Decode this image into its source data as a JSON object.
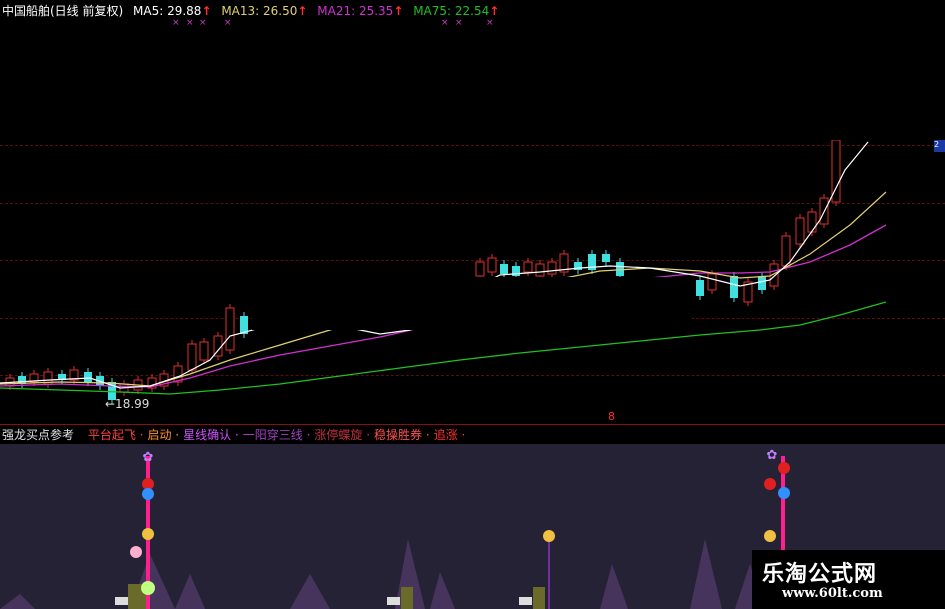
{
  "header": {
    "title": "中国船舶(日线 前复权)",
    "ma5": "MA5: 29.88",
    "ma13": "MA13: 26.50",
    "ma21": "MA21: 25.35",
    "ma75": "MA75: 22.54",
    "arrow": "↑"
  },
  "price_panel": {
    "low_label": "←18.99",
    "marker": "8",
    "axis_tag": "2"
  },
  "indicator": {
    "title": "强龙买点参考",
    "labels": [
      {
        "text": "平台起飞",
        "color": "#ff4040"
      },
      {
        "text": "启动",
        "color": "#ff8c30"
      },
      {
        "text": "星线确认",
        "color": "#d050ff"
      },
      {
        "text": "一阳穿三线",
        "color": "#a040c0"
      },
      {
        "text": "涨停蝶旋",
        "color": "#c03040"
      },
      {
        "text": "稳操胜券",
        "color": "#ff5050"
      },
      {
        "text": "追涨",
        "color": "#ff3030"
      }
    ]
  },
  "watermark": {
    "name": "乐淘公式网",
    "url": "www.60lt.com"
  },
  "colors": {
    "ma5": "#ffffff",
    "ma13": "#e0d070",
    "ma21": "#d030d0",
    "ma75": "#20c020",
    "up": "#e03030",
    "down": "#40e0e0",
    "divider": "#8a1010"
  }
}
